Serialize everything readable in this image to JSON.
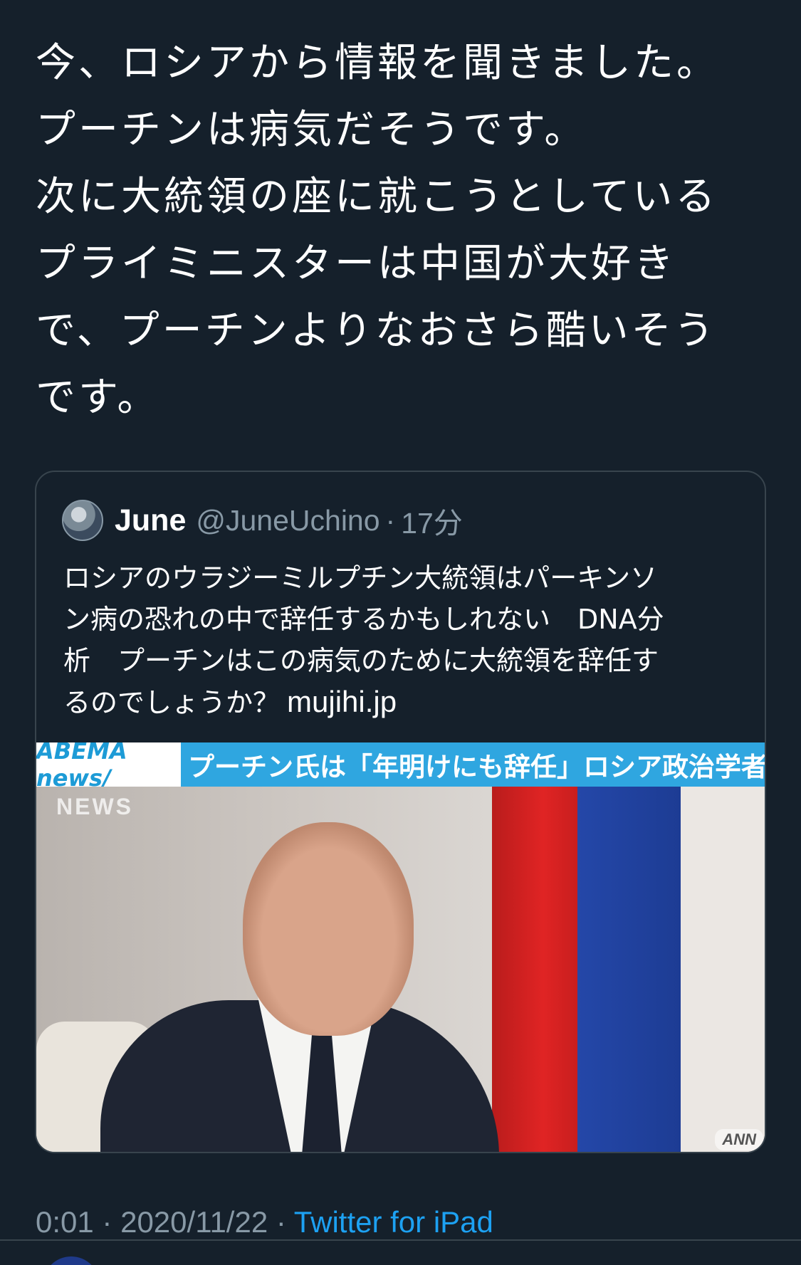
{
  "tweet": {
    "lines": [
      "今、ロシアから情報を聞きました。",
      "プーチンは病気だそうです。",
      "次に大統領の座に就こうとしている",
      "プライミニスターは中国が大好き",
      "で、プーチンよりなおさら酷いそう",
      "です。"
    ],
    "time": "0:01",
    "date": "2020/11/22",
    "source": "Twitter for iPad",
    "separator": "·"
  },
  "quote": {
    "author_name": "June",
    "author_handle": "@JuneUchino",
    "separator": "·",
    "time_ago": "17分",
    "lines": [
      "ロシアのウラジーミルプチン大統領はパーキンソ",
      "ン病の恐れの中で辞任するかもしれない　DNA分",
      "析　プーチンはこの病気のために大統領を辞任す",
      "るのでしょうか？"
    ],
    "link": "mujihi.jp",
    "media": {
      "brand": "ABEMA news/",
      "headline": "プーチン氏は「年明けにも辞任」ロシア政治学者",
      "watermark_top": "NEWS",
      "watermark_bottom": "ANN"
    }
  }
}
